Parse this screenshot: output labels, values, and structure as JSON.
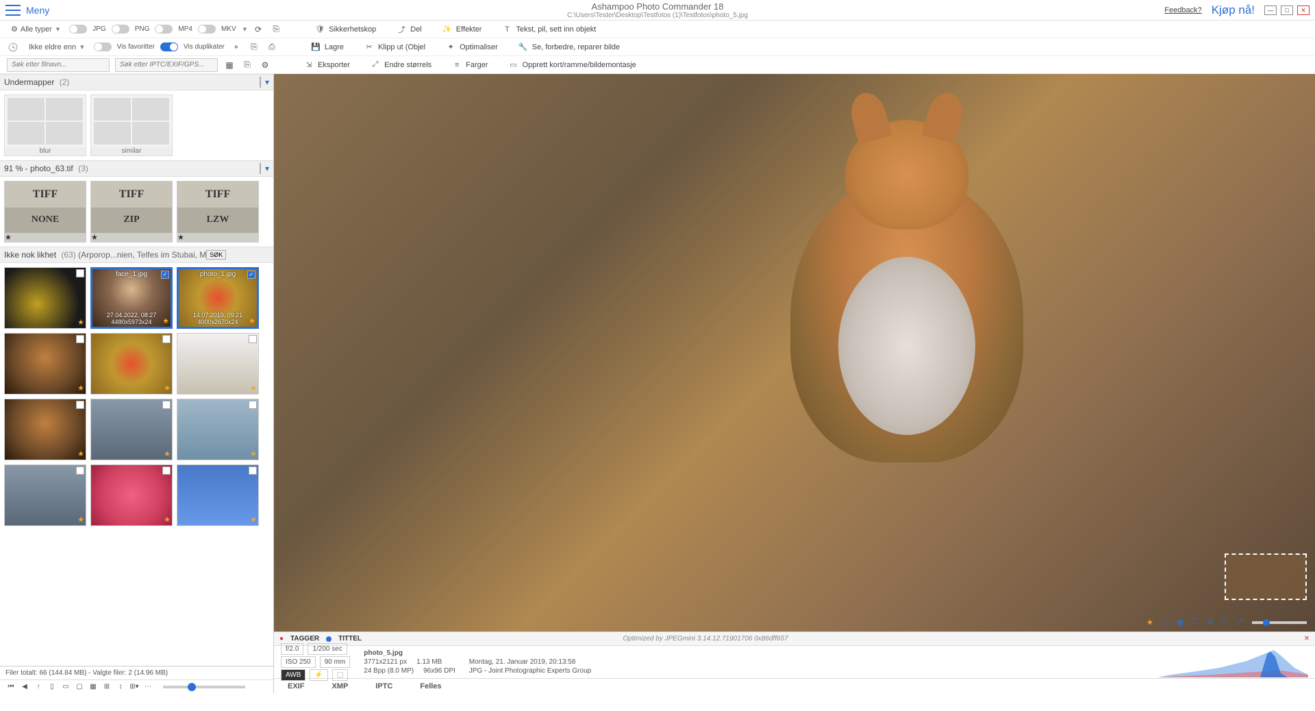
{
  "app": {
    "title": "Ashampoo Photo Commander 18",
    "path": "C:\\Users\\Tester\\Desktop\\Testfotos (1)\\Testfotos\\photo_5.jpg",
    "menu": "Meny",
    "feedback": "Feedback?",
    "buy": "Kjøp nå!"
  },
  "filters": {
    "all_types": "Alle typer",
    "jpg": "JPG",
    "png": "PNG",
    "mp4": "MP4",
    "mkv": "MKV",
    "older_than": "Ikke eldre enn",
    "favorites": "Vis favoritter",
    "duplicates": "Vis duplikater",
    "search_filename": "Søk etter filnavn...",
    "search_meta": "Søk etter IPTC/EXIF/GPS..."
  },
  "ribbon": {
    "r1c1": "Sikkerhetskop",
    "r2c1": "Lagre",
    "r3c1": "Eksporter",
    "r1c2": "Del",
    "r2c2": "Klipp ut (Objel",
    "r3c2": "Endre størrels",
    "r1c3": "Effekter",
    "r2c3": "Optimaliser",
    "r3c3": "Farger",
    "r1c4": "Tekst, pil, sett inn objekt",
    "r2c4": "Se, forbedre, reparer bilde",
    "r3c4": "Opprett kort/ramme/bildemontasje"
  },
  "sections": {
    "subfolders": "Undermapper",
    "subfolders_count": "(2)",
    "folder_blur": "blur",
    "folder_similar": "similar",
    "group1_title": "91 % - photo_63.tif",
    "group1_count": "(3)",
    "tiff": "TIFF",
    "tiff_none": "NONE",
    "tiff_zip": "ZIP",
    "tiff_lzw": "LZW",
    "group2_title": "Ikke nok likhet",
    "group2_count": "(63)",
    "group2_extra": "(Arporop...nien, Telfes im Stubai, M",
    "group2_btn": "SØK"
  },
  "thumbs": {
    "face1_name": "face_1.jpg",
    "face1_date": "27.04.2022, 08:27",
    "face1_dim": "4480x5973x24",
    "photo1_name": "photo_1.jpg",
    "photo1_date": "14.07.2019, 09:21",
    "photo1_dim": "4000x2670x24"
  },
  "tagbar": {
    "tagger": "TAGGER",
    "tittel": "TITTEL",
    "optimized": "Optimized by JPEGmini 3.14.12.71901706 0x86dff657"
  },
  "info": {
    "aperture": "f/2.0",
    "shutter": "1/200 sec",
    "iso": "ISO 250",
    "focal": "90 mm",
    "awb": "AWB",
    "filename": "photo_5.jpg",
    "dims": "3771x2121 px",
    "size": "1.13 MB",
    "bpp": "24 Bpp (8.0 MP)",
    "dpi": "96x96 DPI",
    "date": "Montag, 21. Januar 2019, 20:13:58",
    "format": "JPG - Joint Photographic Experts Group"
  },
  "tabs": {
    "exif": "EXIF",
    "xmp": "XMP",
    "iptc": "IPTC",
    "felles": "Felles"
  },
  "status": {
    "text": "Filer totalt: 66 (144.84 MB) - Valgte filer: 2 (14.96 MB)"
  }
}
